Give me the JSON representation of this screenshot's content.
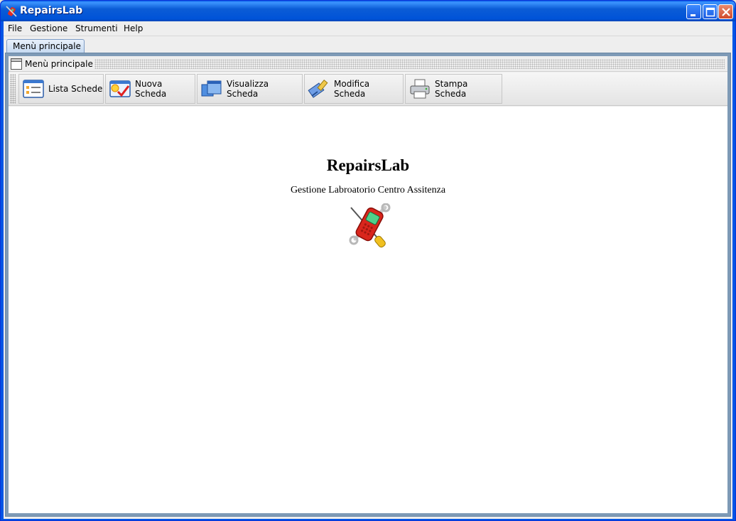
{
  "window": {
    "title": "RepairsLab",
    "icon": "wrench-phone-icon"
  },
  "title_controls": [
    {
      "name": "minimize-icon"
    },
    {
      "name": "maximize-icon"
    },
    {
      "name": "close-icon"
    }
  ],
  "menubar": {
    "items": [
      "File",
      "Gestione",
      "Strumenti",
      "Help"
    ]
  },
  "tabs": [
    {
      "label": "Menù principale",
      "selected": true
    }
  ],
  "panel": {
    "title": "Menù principale",
    "icon": "window-icon"
  },
  "toolbar": {
    "buttons": [
      {
        "label": "Lista Schede",
        "icon": "list-icon"
      },
      {
        "label": "Nuova Scheda",
        "icon": "new-card-icon"
      },
      {
        "label": "Visualizza Scheda",
        "icon": "view-windows-icon"
      },
      {
        "label": "Modifica Scheda",
        "icon": "edit-brush-icon"
      },
      {
        "label": "Stampa Scheda",
        "icon": "printer-icon"
      }
    ]
  },
  "content": {
    "title": "RepairsLab",
    "subtitle": "Gestione Labroatorio Centro Assitenza",
    "logo": "phone-repair-logo"
  },
  "colors": {
    "titlebar": "#0055e5",
    "tab_selected": "#c6daf1",
    "panel_border": "#7e9ab6",
    "logo_red": "#d9261c"
  }
}
